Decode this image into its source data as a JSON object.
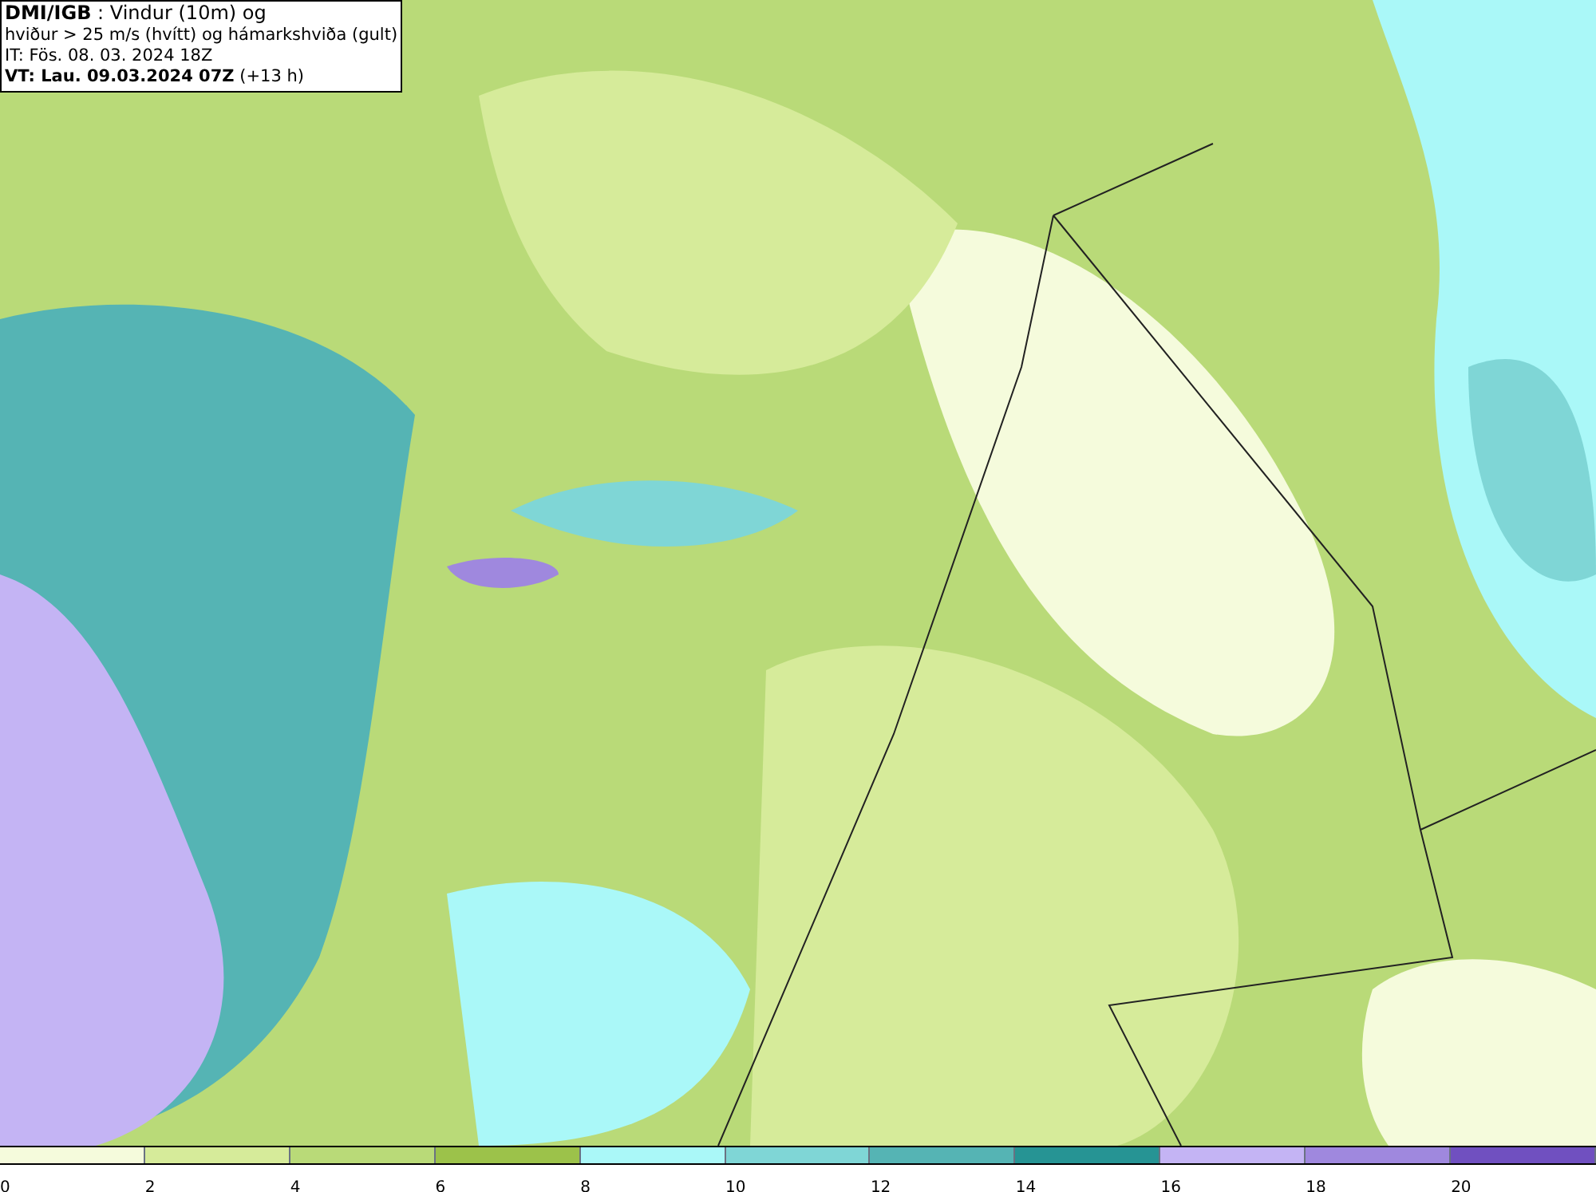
{
  "legend": {
    "lines": [
      "**DMI/IGB** : Vindur (10m) og",
      "hviður > 25 m/s (hvítt) og hámarkshviða (gult)",
      "IT: Fös. 08. 03. 2024 18Z",
      "**VT: Lau. 09.03.2024 07Z** (+13 h)"
    ]
  },
  "colorbar": [
    {
      "color": "#f5fbdc",
      "label": "0"
    },
    {
      "color": "#d6eb9a",
      "label": "2"
    },
    {
      "color": "#b9da78",
      "label": "4"
    },
    {
      "color": "#9cc24a",
      "label": "6"
    },
    {
      "color": "#aaf8f8",
      "label": "8"
    },
    {
      "color": "#7fd6d6",
      "label": "10"
    },
    {
      "color": "#55b4b4",
      "label": "12"
    },
    {
      "color": "#269494",
      "label": "14"
    },
    {
      "color": "#c4b4f4",
      "label": "16"
    },
    {
      "color": "#9f88de",
      "label": "18"
    },
    {
      "color": "#7050c0",
      "label": "20"
    }
  ]
}
